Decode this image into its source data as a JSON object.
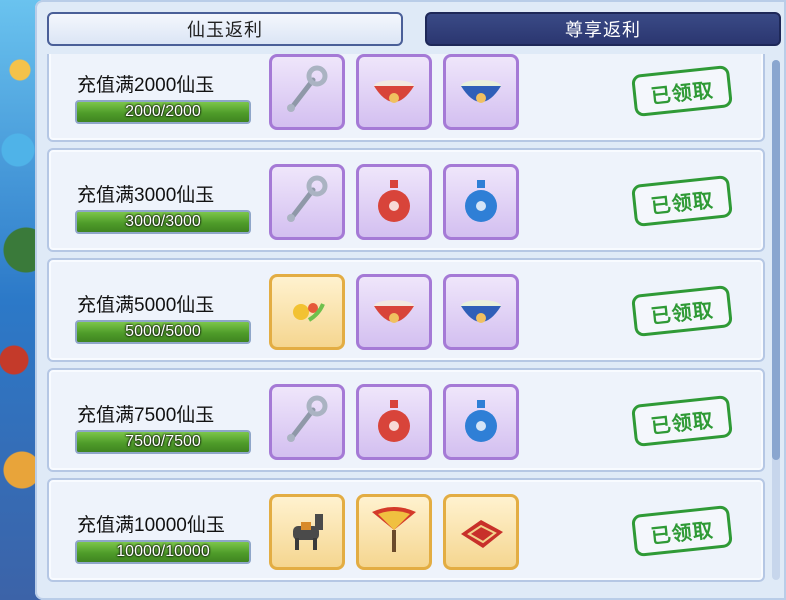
{
  "tabs": {
    "active_label": "仙玉返利",
    "inactive_label": "尊享返利"
  },
  "rewards": [
    {
      "title": "充值满2000仙玉",
      "progress": "2000/2000",
      "progress_fraction": 1.0,
      "items": [
        {
          "icon": "ruyi-key-icon",
          "frame": "purple"
        },
        {
          "icon": "red-bowl-icon",
          "frame": "purple"
        },
        {
          "icon": "blue-bowl-icon",
          "frame": "purple"
        }
      ],
      "status": "已领取"
    },
    {
      "title": "充值满3000仙玉",
      "progress": "3000/3000",
      "progress_fraction": 1.0,
      "items": [
        {
          "icon": "ruyi-key-icon",
          "frame": "purple"
        },
        {
          "icon": "red-vase-icon",
          "frame": "purple"
        },
        {
          "icon": "blue-vase-icon",
          "frame": "purple"
        }
      ],
      "status": "已领取"
    },
    {
      "title": "充值满5000仙玉",
      "progress": "5000/5000",
      "progress_fraction": 1.0,
      "items": [
        {
          "icon": "golden-fruit-icon",
          "frame": "gold"
        },
        {
          "icon": "red-bowl-icon",
          "frame": "purple"
        },
        {
          "icon": "blue-bowl-icon",
          "frame": "purple"
        }
      ],
      "status": "已领取"
    },
    {
      "title": "充值满7500仙玉",
      "progress": "7500/7500",
      "progress_fraction": 1.0,
      "items": [
        {
          "icon": "ruyi-key-icon",
          "frame": "purple"
        },
        {
          "icon": "red-vase-icon",
          "frame": "purple"
        },
        {
          "icon": "blue-vase-icon",
          "frame": "purple"
        }
      ],
      "status": "已领取"
    },
    {
      "title": "充值满10000仙玉",
      "progress": "10000/10000",
      "progress_fraction": 1.0,
      "items": [
        {
          "icon": "donkey-mount-icon",
          "frame": "gold"
        },
        {
          "icon": "feather-fan-icon",
          "frame": "gold"
        },
        {
          "icon": "red-carpet-icon",
          "frame": "gold"
        }
      ],
      "status": "已领取"
    }
  ],
  "colors": {
    "claimed_stamp": "#2f9a36",
    "progress_green": "#4f9c2a",
    "purple_frame": "#a57ad6",
    "gold_frame": "#e3ad43"
  }
}
